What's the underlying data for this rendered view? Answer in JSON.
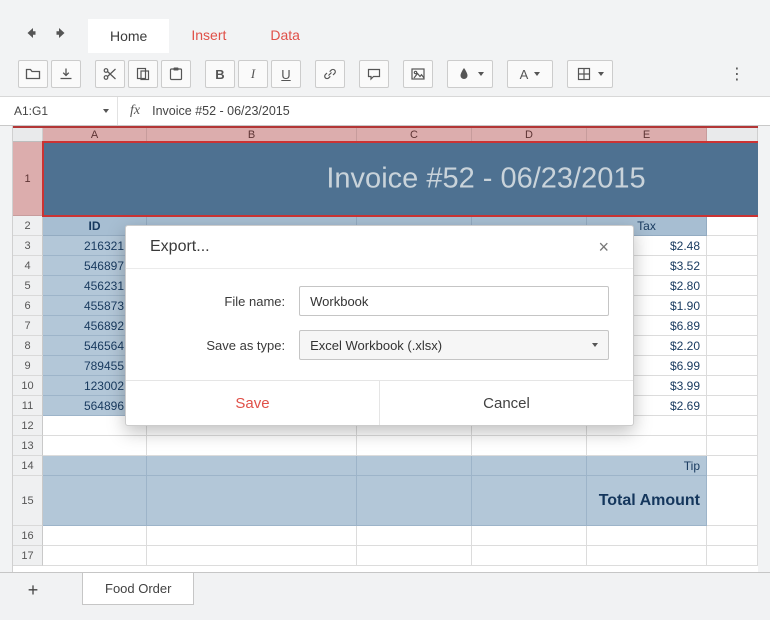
{
  "tabstrip": {
    "tabs": [
      {
        "label": "Home"
      },
      {
        "label": "Insert"
      },
      {
        "label": "Data"
      }
    ],
    "active": "Home"
  },
  "toolbar": {
    "bold": "B",
    "italic": "I",
    "underline": "U",
    "font_color": "A",
    "overflow": "⋮"
  },
  "formula_bar": {
    "name_box": "A1:G1",
    "fx": "fx",
    "value": "Invoice #52 - 06/23/2015"
  },
  "sheet": {
    "columns": [
      "A",
      "B",
      "C",
      "D",
      "E"
    ],
    "row_numbers": [
      "1",
      "2",
      "3",
      "4",
      "5",
      "6",
      "7",
      "8",
      "9",
      "10",
      "11",
      "12",
      "13",
      "14",
      "15",
      "16",
      "17"
    ],
    "banner": "Invoice #52 - 06/23/2015",
    "id_header": "ID",
    "tax_header": "Tax",
    "ids": [
      "216321",
      "546897",
      "456231",
      "455873",
      "456892",
      "546564",
      "789455",
      "123002",
      "564896"
    ],
    "taxes": [
      "$2.48",
      "$3.52",
      "$2.80",
      "$1.90",
      "$6.89",
      "$2.20",
      "$6.99",
      "$3.99",
      "$2.69"
    ],
    "tip": "Tip",
    "total": "Total Amount"
  },
  "dialog": {
    "title": "Export...",
    "close_label": "×",
    "file_name_label": "File name:",
    "file_name_value": "Workbook",
    "save_as_label": "Save as type:",
    "save_as_value": "Excel Workbook (.xlsx)",
    "save_label": "Save",
    "cancel_label": "Cancel"
  },
  "sheet_bar": {
    "add": "+",
    "tab": "Food Order"
  },
  "colors": {
    "accent_red": "#e05048",
    "selection_red": "#cc3333",
    "banner_blue": "#4e7191",
    "cell_blue": "#b3c7d8",
    "header_pink": "#dcadad"
  }
}
